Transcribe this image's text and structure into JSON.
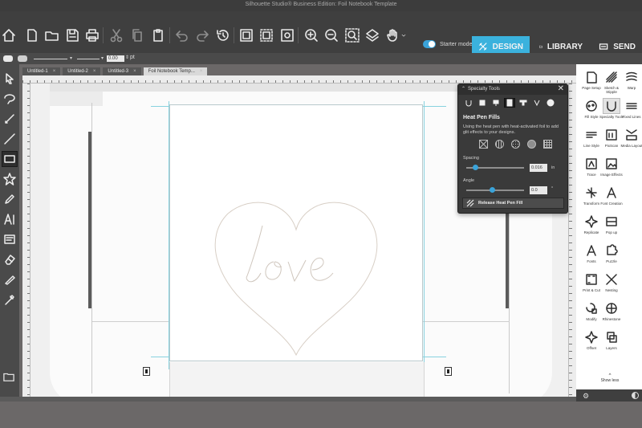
{
  "window": {
    "title": "Silhouette Studio® Business Edition: Foil Notebook Template"
  },
  "toolbar": {
    "starter_mode_label": "Starter mode on",
    "tabs": [
      {
        "label": "DESIGN",
        "active": true,
        "icon": "design-icon"
      },
      {
        "label": "LIBRARY",
        "active": false,
        "icon": "folder-icon"
      },
      {
        "label": "SEND",
        "active": false,
        "icon": "send-icon"
      }
    ]
  },
  "options_bar": {
    "line_width_value": "0.00",
    "line_width_unit": "pt"
  },
  "doc_tabs": [
    {
      "label": "Untitled-1",
      "active": false
    },
    {
      "label": "Untitled-2",
      "active": false
    },
    {
      "label": "Untitled-3",
      "active": false
    },
    {
      "label": "Foil Notebook Temp...",
      "active": true
    }
  ],
  "design": {
    "text": "love",
    "shape": "heart"
  },
  "specialty_panel": {
    "title": "Specialty Tools",
    "section_title": "Heat Pen Fills",
    "description": "Using the heat pen with heat-activated foil to add glit effects to your designs.",
    "spacing_label": "Spacing",
    "spacing_value": "0.016",
    "spacing_unit": "in",
    "spacing_fraction": 0.15,
    "angle_label": "Angle",
    "angle_value": "0.0",
    "angle_unit": "°",
    "angle_fraction": 0.45,
    "release_label": "Release Heat Pen Fill"
  },
  "right_panel": {
    "items": [
      {
        "label": "Page Setup"
      },
      {
        "label": "Sketch & Stipple"
      },
      {
        "label": "Warp"
      },
      {
        "label": "Fill Style"
      },
      {
        "label": "Specialty Tools"
      },
      {
        "label": "Fixed Lines"
      },
      {
        "label": "Line Style"
      },
      {
        "label": "PixScan"
      },
      {
        "label": "Media Layout"
      },
      {
        "label": "Trace"
      },
      {
        "label": "Image Effects"
      },
      {
        "label": ""
      },
      {
        "label": "Transform"
      },
      {
        "label": "Font Creation"
      },
      {
        "label": ""
      },
      {
        "label": "Replicate"
      },
      {
        "label": "Pop up"
      },
      {
        "label": ""
      },
      {
        "label": "Fonts"
      },
      {
        "label": "Puzzle"
      },
      {
        "label": ""
      },
      {
        "label": "Print & Cut"
      },
      {
        "label": "Nesting"
      },
      {
        "label": ""
      },
      {
        "label": "Modify"
      },
      {
        "label": "Rhinestone"
      },
      {
        "label": ""
      },
      {
        "label": "Offset"
      },
      {
        "label": "Layers"
      },
      {
        "label": ""
      }
    ],
    "show_less_label": "Show less"
  }
}
